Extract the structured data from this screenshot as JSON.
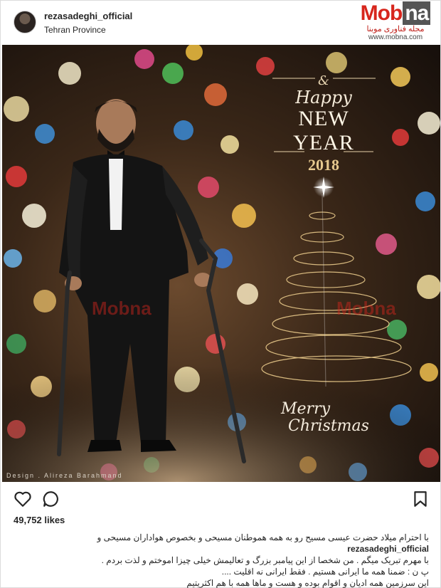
{
  "post": {
    "username": "rezasadeghi_official",
    "location": "Tehran Province"
  },
  "watermark": {
    "brand_prefix": "Mob",
    "brand_suffix": "na",
    "subtitle": "مجله فناوری موبنا",
    "url": "www.mobna.com",
    "color": "#d7261d"
  },
  "photo": {
    "greeting": {
      "amp": "&",
      "happy": "Happy",
      "new_year": "NEW YEAR",
      "year": "2018"
    },
    "merry": {
      "line1": "Merry",
      "line2": "Christmas"
    },
    "credit": "Design . Alireza Barahmand",
    "watermark_text": "Mobna"
  },
  "actions": {
    "like_icon": "heart-icon",
    "comment_icon": "comment-icon",
    "save_icon": "bookmark-icon"
  },
  "likes": "49,752 likes",
  "caption": {
    "user": "rezasadeghi_official",
    "line1": "با احترام میلاد حضرت عیسی مسیح رو به همه هموطنان مسیحی و بخصوص هواداران مسیحی و",
    "line2": "با مهرم تبریک میگم . من شخصا از این پیامبر بزرگ و تعالیمش خیلی چیزا اموختم و لذت بردم .",
    "line3": "پ ن : ضمنا همه ما ایرانی هستیم . فقط ایرانی نه اقلیت ....",
    "line4": "این سرزمین همه ادیان و اقوام بوده و هست و ماها همه با هم اکثریتیم"
  }
}
